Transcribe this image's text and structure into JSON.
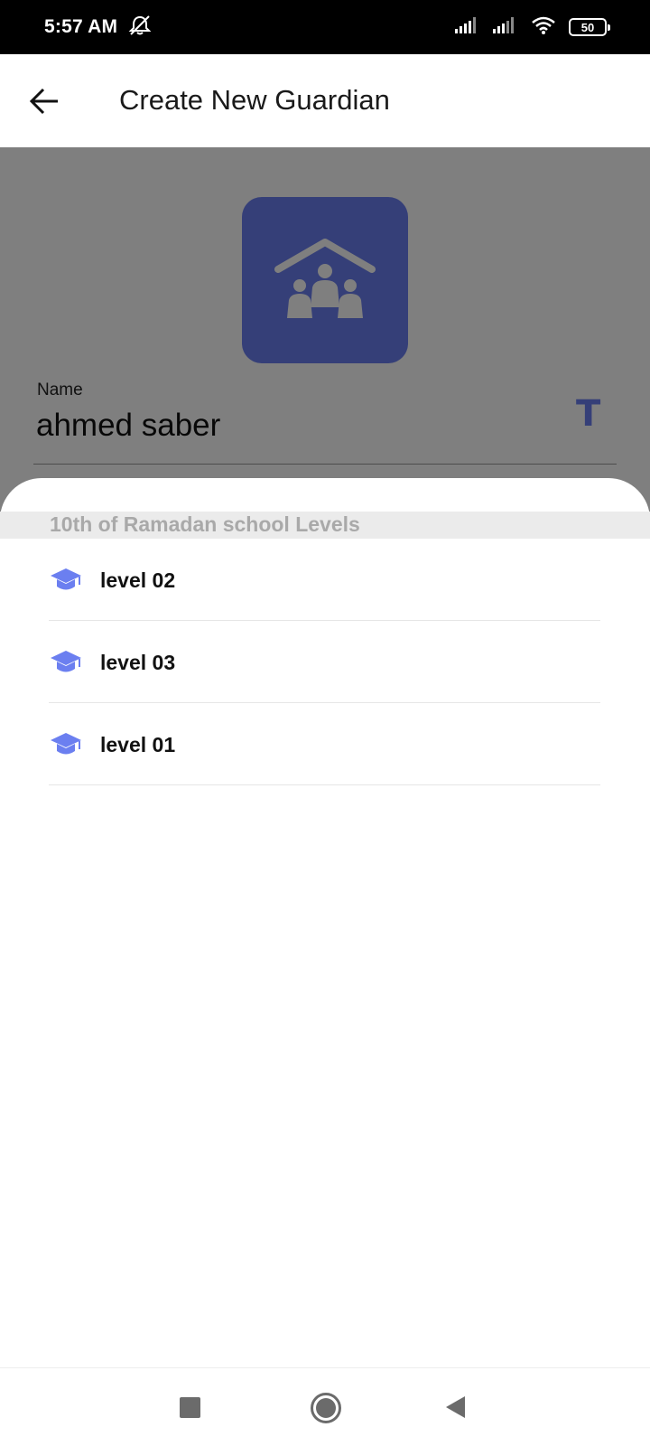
{
  "status_bar": {
    "time": "5:57 AM",
    "battery": "50",
    "icons": [
      "alarm-off-icon",
      "signal-icon",
      "signal-icon",
      "wifi-icon",
      "battery-icon"
    ]
  },
  "app_bar": {
    "title": "Create New Guardian",
    "back_icon": "arrow-back-icon"
  },
  "form": {
    "avatar_icon": "family-home-icon",
    "name_label": "Name",
    "name_value": "ahmed saber",
    "name_field_icon": "text-type-icon",
    "name_field_icon_glyph": "T"
  },
  "sheet": {
    "title": "10th of Ramadan school Levels",
    "levels": [
      {
        "label": "level 02",
        "icon": "graduation-cap-icon"
      },
      {
        "label": "level 03",
        "icon": "graduation-cap-icon"
      },
      {
        "label": "level 01",
        "icon": "graduation-cap-icon"
      }
    ]
  },
  "nav_bar": {
    "recent_icon": "square-icon",
    "home_icon": "circle-icon",
    "back_icon": "triangle-back-icon"
  },
  "colors": {
    "accent": "#6b7ff0",
    "scrim": "#000000",
    "sheet_header_bg": "#ebebeb",
    "sheet_title": "#a9a9a9"
  }
}
